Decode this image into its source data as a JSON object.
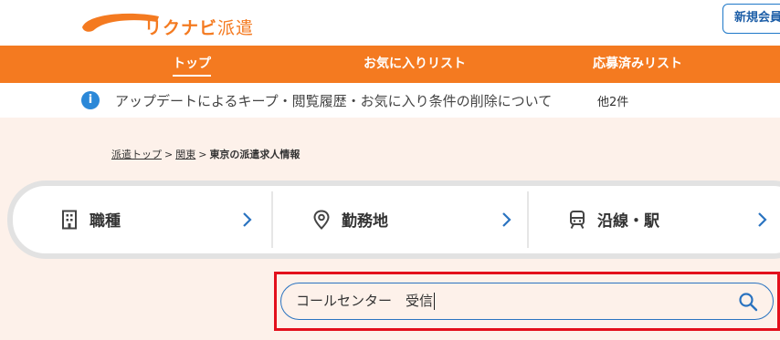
{
  "header": {
    "logo_main": "リクナビ",
    "logo_sub": "派遣",
    "register_label": "新規会員登録"
  },
  "nav": {
    "items": [
      {
        "label": "トップ",
        "active": true
      },
      {
        "label": "お気に入りリスト",
        "active": false
      },
      {
        "label": "応募済みリスト",
        "active": false
      }
    ]
  },
  "notice": {
    "icon": "info-icon",
    "text": "アップデートによるキープ・閲覧履歴・お気に入り条件の削除について",
    "more": "他2件"
  },
  "breadcrumb": {
    "items": [
      "派遣トップ",
      "関東"
    ],
    "current": "東京の派遣求人情報",
    "separator": ">"
  },
  "filters": [
    {
      "label": "職種",
      "icon": "building-icon"
    },
    {
      "label": "勤務地",
      "icon": "location-pin-icon"
    },
    {
      "label": "沿線・駅",
      "icon": "train-icon"
    }
  ],
  "search": {
    "value": "コールセンター　受信",
    "icon": "search-icon"
  },
  "colors": {
    "brand_orange": "#f47a20",
    "accent_blue": "#2a73c0",
    "content_bg": "#fdf1ea",
    "highlight_red": "#e3101c"
  }
}
